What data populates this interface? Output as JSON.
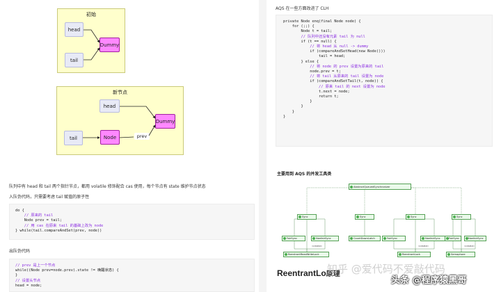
{
  "left": {
    "diagram1": {
      "title": "初始",
      "nodes": {
        "head": "head",
        "tail": "tail",
        "dummy": "Dummy"
      }
    },
    "diagram2": {
      "title": "新节点",
      "nodes": {
        "head": "head",
        "tail": "tail",
        "node": "Node",
        "dummy": "Dummy",
        "prev": "prev"
      }
    },
    "para1": "队列中有 head 和 tail 两个指针节点，都用 volatile 修饰配合 cas 使用，每个节点有 state 维护节点状态",
    "para2": "入队伪代码，只需要考虑 tail 赋值的原子性",
    "code1": [
      "do {",
      "    // 原来的 tail",
      "    Node prev = tail;",
      "    // 用 cas 在原来 tail 的基础上改为 node",
      "} while(tail.compareAndSet(prev, node))"
    ],
    "para3": "出队伪代码",
    "code2": [
      "// prev 是上一个节点",
      "while((Node prev=node.prev).state != 唤醒状态) {",
      "}",
      "// 设置头节点",
      "head = node;"
    ]
  },
  "right": {
    "heading": "AQS 在一些方面改进了 CLH",
    "code": [
      "private Node enq(final Node node) {",
      "    for (;;) {",
      "        Node t = tail;",
      "        // 队列中还没有元素 tail 为 null",
      "        if (t == null) {",
      "            // 将 head 从 null -> dummy",
      "            if (compareAndSetHead(new Node()))",
      "                tail = head;",
      "        } else {",
      "            // 将 node 的 prev 设置为原来的 tail",
      "            node.prev = t;",
      "            // 将 tail 从原来的 tail 设置为 node",
      "            if (compareAndSetTail(t, node)) {",
      "                // 原来 tail 的 next 设置为 node",
      "                t.next = node;",
      "                return t;",
      "            }",
      "        }",
      "    }",
      "}"
    ],
    "tools_title": "主要用到 AQS 的并发工具类",
    "class_diagram": {
      "root": "AbstractQueuedSynchronizer",
      "sync": "Sync",
      "fair": "FairSync",
      "nonfair": "NonfairSync",
      "countdown": "CountDownLatch",
      "rrwl": "ReentrantReadWriteLock",
      "rl": "ReentrantLock",
      "sem": "Semaphore",
      "rel_label": "«create»"
    },
    "bottom_title": "ReentrantLo",
    "bottom_title2": "原理"
  },
  "watermarks": {
    "w1": "知乎 @爱代码不爱敲代码",
    "w2": "头条 @程序猿黑哥"
  }
}
